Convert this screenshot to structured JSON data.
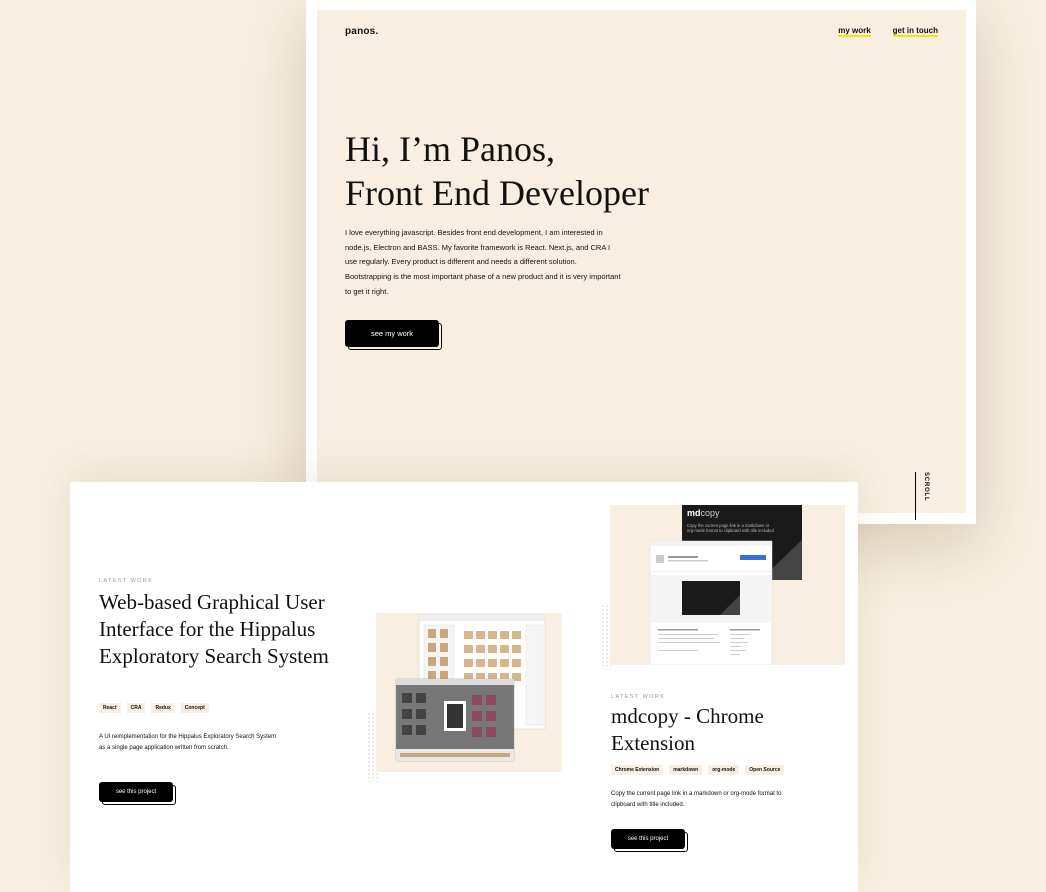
{
  "header": {
    "logo": "panos.",
    "nav": [
      {
        "label": "my work"
      },
      {
        "label": "get in touch"
      }
    ]
  },
  "hero": {
    "title_line1": "Hi, I’m Panos,",
    "title_line2": "Front End Developer",
    "text": "I love everything javascript. Besides front end development, I am interested in node.js, Electron and BASS. My favorite framework is React. Next.js, and CRA I use regularly. Every product is different and needs a different solution. Bootstrapping is the most important phase of a new product and it is very important to get it right.",
    "button_label": "see my work",
    "scroll_label": "SCROLL"
  },
  "projects": [
    {
      "eyebrow": "LATEST WORK",
      "title": "Web-based Graphical User Interface for the Hippalus Exploratory Search System",
      "tags": [
        "React",
        "CRA",
        "Redux",
        "Concept"
      ],
      "description": "A UI reimplementation for the Hippalus Exploratory Search System as a single page application written from scratch.",
      "button_label": "see this project"
    },
    {
      "eyebrow": "LATEST WORK",
      "title": "mdcopy - Chrome Extension",
      "tags": [
        "Chrome Extension",
        "markdown",
        "org-mode",
        "Open Source"
      ],
      "description": "Copy the current page link in a markdown or org-mode format to clipboard with title included.",
      "button_label": "see this project",
      "screenshot_brand": "mdcopy",
      "screenshot_text": "Copy the current page link in a markdown or org-mode format to clipboard with title included"
    }
  ],
  "colors": {
    "background": "#f8efe2",
    "accent_underline": "#f3e600",
    "button": "#000000"
  }
}
